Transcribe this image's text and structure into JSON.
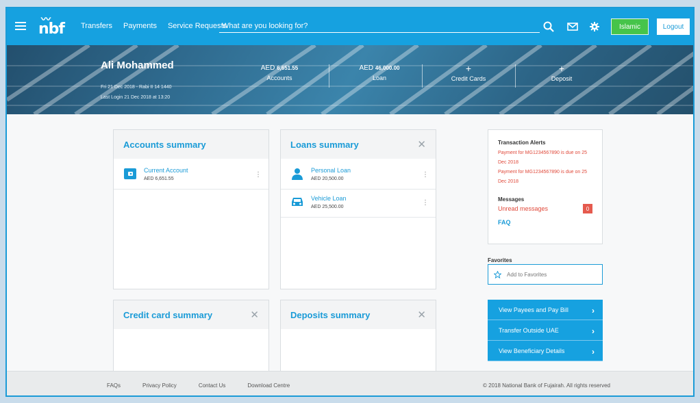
{
  "brand": {
    "logo_text": "nbf"
  },
  "nav": {
    "items": [
      "Transfers",
      "Payments",
      "Service Requests"
    ]
  },
  "search": {
    "placeholder": "What are you looking for?"
  },
  "header_buttons": {
    "islamic": "Islamic",
    "logout": "Logout"
  },
  "hero": {
    "user_name": "Ali Mohammed",
    "date_line": "Fri 21 Dec 2018 - Rabi II 14 1440",
    "last_login": "Last Login 21 Dec 2018 at 13:20",
    "stats": [
      {
        "currency": "AED",
        "amount": "6,651.55",
        "label": "Accounts"
      },
      {
        "currency": "AED",
        "amount": "46,000.00",
        "label": "Loan"
      },
      {
        "symbol": "+",
        "label": "Credit Cards"
      },
      {
        "symbol": "+",
        "label": "Deposit"
      }
    ]
  },
  "accounts_summary": {
    "title": "Accounts summary",
    "items": [
      {
        "name": "Current Account",
        "amount": "AED 6,651.55"
      }
    ]
  },
  "loans_summary": {
    "title": "Loans summary",
    "close_glyph": "✕",
    "items": [
      {
        "name": "Personal Loan",
        "amount": "AED 20,500.00"
      },
      {
        "name": "Vehicle Loan",
        "amount": "AED 25,500.00"
      }
    ]
  },
  "credit_card_summary": {
    "title": "Credit card summary",
    "close_glyph": "✕"
  },
  "deposits_summary": {
    "title": "Deposits summary",
    "close_glyph": "✕"
  },
  "menu_glyph": "⋮",
  "alerts_panel": {
    "title": "Transaction Alerts",
    "alerts": [
      "Payment for MG1234567890 is due on 25 Dec 2018",
      "Payment for MG1234567890 is due on 25 Dec 2018"
    ],
    "messages_title": "Messages",
    "unread_label": "Unread messages",
    "unread_count": "0",
    "faq_label": "FAQ"
  },
  "favorites": {
    "label": "Favorites",
    "add_label": "Add to Favorites"
  },
  "quick_links": [
    "View Payees and Pay Bill",
    "Transfer Outside UAE",
    "View Beneficiary Details"
  ],
  "footer": {
    "links": [
      "FAQs",
      "Privacy Policy",
      "Contact Us",
      "Download Centre"
    ],
    "copyright": "© 2018 National Bank of Fujairah. All rights reserved"
  },
  "colors": {
    "primary": "#16a1e0",
    "islamic": "#46c44a",
    "alert": "#e0493a"
  },
  "icons": [
    "menu-icon",
    "search-icon",
    "mail-icon",
    "gear-icon",
    "wallet-icon",
    "person-icon",
    "car-icon",
    "star-icon",
    "chevron-right-icon",
    "close-icon"
  ]
}
